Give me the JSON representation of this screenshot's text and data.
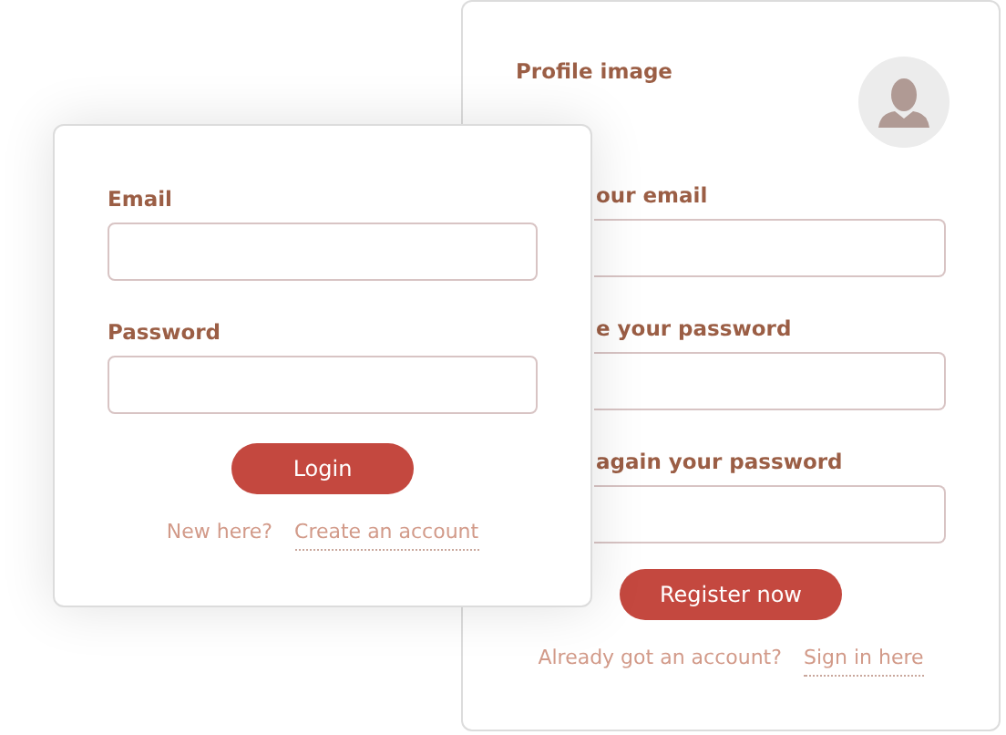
{
  "register_card": {
    "profile_label": "Profile image",
    "fields": [
      {
        "label": "our email"
      },
      {
        "label": "e your password"
      },
      {
        "label": "again your password"
      }
    ],
    "button": "Register now",
    "prompt": "Already got an account?",
    "link": "Sign in here"
  },
  "login_card": {
    "fields": [
      {
        "label": "Email"
      },
      {
        "label": "Password"
      }
    ],
    "button": "Login",
    "prompt": "New here?",
    "link": "Create an account"
  }
}
